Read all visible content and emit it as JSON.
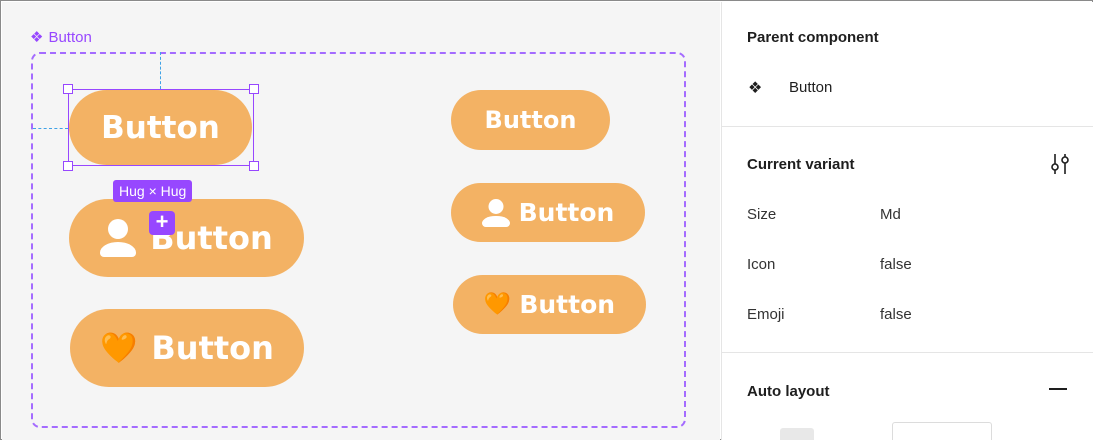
{
  "canvas": {
    "component_label": "Button",
    "hug_label": "Hug × Hug",
    "plus_label": "+",
    "buttons": {
      "lg_plain": "Button",
      "lg_icon": "Button",
      "lg_emoji": "Button",
      "md_plain": "Button",
      "md_icon": "Button",
      "md_emoji": "Button"
    },
    "emoji": "🧡",
    "colors": {
      "button": "#f3b264",
      "selection": "#9747ff",
      "guide": "#3fa2e6"
    }
  },
  "panel": {
    "parent_component": {
      "title": "Parent component",
      "name": "Button"
    },
    "current_variant": {
      "title": "Current variant",
      "props": [
        {
          "key": "Size",
          "value": "Md"
        },
        {
          "key": "Icon",
          "value": "false"
        },
        {
          "key": "Emoji",
          "value": "false"
        }
      ]
    },
    "auto_layout": {
      "title": "Auto layout"
    }
  },
  "icons": [
    "component-icon",
    "person-icon",
    "heart-emoji-icon",
    "adjust-properties-icon",
    "minus-icon"
  ]
}
